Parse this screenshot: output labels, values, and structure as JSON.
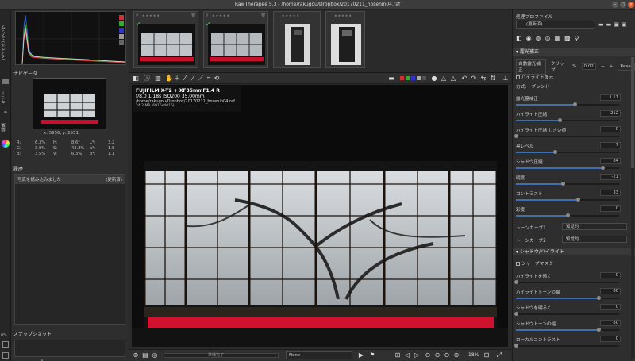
{
  "window": {
    "title": "RawTherapee 5.3 - /home/rakugou/Dropbox/20170211_hosenin04.raf"
  },
  "left_strip": {
    "tabs": [
      "ファイルブラウザ",
      "キュー",
      "編集"
    ],
    "bottom_label": "0%"
  },
  "navigator": {
    "header": "ナビゲータ",
    "coords": "x: 5956, y: 2551",
    "rows": [
      [
        "R:",
        "6.3%",
        "H:",
        "8.6°",
        "L*:",
        "3.2"
      ],
      [
        "G:",
        "3.9%",
        "S:",
        "43.8%",
        "a*:",
        "1.8"
      ],
      [
        "B:",
        "3.5%",
        "V:",
        "6.3%",
        "b*:",
        "1.1"
      ]
    ]
  },
  "history": {
    "header": "履歴",
    "item_label": "写真を読み込みました",
    "item_value": "(更新済)"
  },
  "snapshot": {
    "header": "スナップショット",
    "add": "+",
    "remove": "−"
  },
  "filmstrip": {
    "thumbs": [
      {
        "stars": "★★★★★",
        "checked": true
      },
      {
        "stars": "★★★★★",
        "checked": true
      },
      {
        "stars": "★★★★★",
        "checked": false
      },
      {
        "stars": "★★★★★",
        "checked": false
      }
    ]
  },
  "exif": {
    "line1": "FUJIFILM X-T2 + XF35mmF1.4 R",
    "line2": "f/8.0  1/18s  ISO200  35.00mm",
    "line3": "/home/rakugou/Dropbox/20170211_hosenin04.raf",
    "line4": "24.2 MP (6016x4016)"
  },
  "bottombar": {
    "status": "準備完了",
    "profile": "None",
    "zoom": "18%"
  },
  "right_panel": {
    "profile_header": "処理プロファイル",
    "profile_value": "(更新済)",
    "exposure_header": "露光補正",
    "auto_label": "自動露光補正",
    "clip_label": "クリップ",
    "clip_unit": "%",
    "clip_value": "0.02",
    "reset_label": "Reset",
    "highlight_recovery": "ハイライト復元",
    "method_label": "方式:",
    "method_value": "ブレンド",
    "sliders": [
      {
        "label": "露光量補正",
        "value": "1.11",
        "pos": 0.57
      },
      {
        "label": "ハイライト圧縮",
        "value": "212",
        "pos": 0.42
      },
      {
        "label": "ハイライト圧縮 しきい値",
        "value": "0",
        "pos": 0.0
      },
      {
        "label": "黒レベル",
        "value": "7",
        "pos": 0.38
      },
      {
        "label": "シャドウ圧縮",
        "value": "84",
        "pos": 0.84
      },
      {
        "label": "明度",
        "value": "-21",
        "pos": 0.45
      },
      {
        "label": "コントラスト",
        "value": "33",
        "pos": 0.6
      },
      {
        "label": "彩度",
        "value": "0",
        "pos": 0.5
      }
    ],
    "tone_curve_1": "トーンカーブ1",
    "tone_curve_2": "トーンカーブ2",
    "tone_curve_value": "知覚的",
    "sh_header": "シャドウ/ハイライト",
    "sharp_mask": "シャープマスク",
    "sh_sliders": [
      {
        "label": "ハイライトを暗く",
        "value": "0",
        "pos": 0.0
      },
      {
        "label": "ハイライトトーンの幅",
        "value": "80",
        "pos": 0.8
      },
      {
        "label": "シャドウを明るく",
        "value": "0",
        "pos": 0.0
      },
      {
        "label": "シャドウトーンの幅",
        "value": "80",
        "pos": 0.8
      },
      {
        "label": "ローカルコントラスト",
        "value": "0",
        "pos": 0.0
      }
    ]
  }
}
